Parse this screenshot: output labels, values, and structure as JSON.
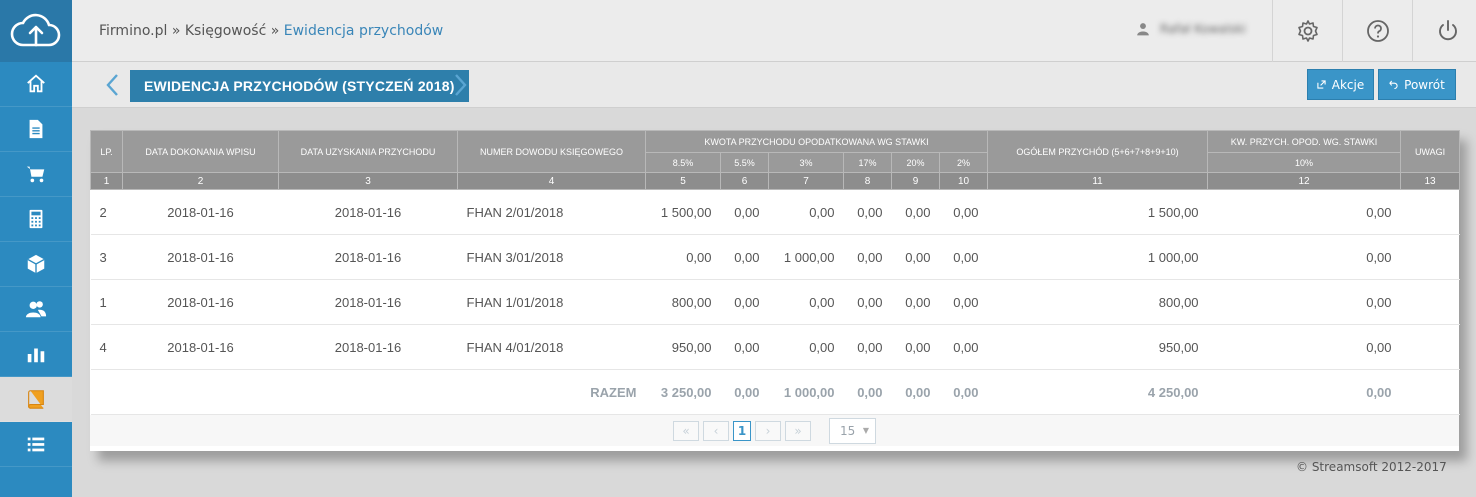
{
  "sidebar": {
    "items": [
      {
        "icon": "home-icon"
      },
      {
        "icon": "document-icon"
      },
      {
        "icon": "cart-icon"
      },
      {
        "icon": "calculator-icon"
      },
      {
        "icon": "box-icon"
      },
      {
        "icon": "users-icon"
      },
      {
        "icon": "bar-chart-icon"
      },
      {
        "icon": "book-icon",
        "active": true
      },
      {
        "icon": "list-icon"
      }
    ]
  },
  "topbar": {
    "breadcrumb": {
      "part1": "Firmino.pl",
      "sep": " » ",
      "part2": "Księgowość",
      "current": "Ewidencja przychodów"
    },
    "user_name": "Rafał Kowalski"
  },
  "header": {
    "title": "EWIDENCJA PRZYCHODÓW (STYCZEŃ 2018)",
    "actions_label": "Akcje",
    "back_label": "Powrót"
  },
  "table": {
    "headers": {
      "lp": "LP.",
      "date_entry": "DATA DOKONANIA WPISU",
      "date_income": "DATA UZYSKANIA PRZYCHODU",
      "doc_number": "NUMER DOWODU KSIĘGOWEGO",
      "amount_group": "KWOTA PRZYCHODU OPODATKOWANA WG STAWKI",
      "rates": [
        "8.5%",
        "5.5%",
        "3%",
        "17%",
        "20%",
        "2%"
      ],
      "total": "OGÓŁEM PRZYCHÓD (5+6+7+8+9+10)",
      "kw_group": "KW. PRZYCH. OPOD. WG. STAWKI",
      "kw_rate": "10%",
      "notes": "UWAGI",
      "col_numbers": [
        "1",
        "2",
        "3",
        "4",
        "5",
        "6",
        "7",
        "8",
        "9",
        "10",
        "11",
        "12",
        "13"
      ]
    },
    "rows": [
      {
        "lp": "2",
        "date_entry": "2018-01-16",
        "date_income": "2018-01-16",
        "doc": "FHAN 2/01/2018",
        "r85": "1 500,00",
        "r55": "0,00",
        "r3": "0,00",
        "r17": "0,00",
        "r20": "0,00",
        "r2": "0,00",
        "total": "1 500,00",
        "kw10": "0,00",
        "notes": ""
      },
      {
        "lp": "3",
        "date_entry": "2018-01-16",
        "date_income": "2018-01-16",
        "doc": "FHAN 3/01/2018",
        "r85": "0,00",
        "r55": "0,00",
        "r3": "1 000,00",
        "r17": "0,00",
        "r20": "0,00",
        "r2": "0,00",
        "total": "1 000,00",
        "kw10": "0,00",
        "notes": ""
      },
      {
        "lp": "1",
        "date_entry": "2018-01-16",
        "date_income": "2018-01-16",
        "doc": "FHAN 1/01/2018",
        "r85": "800,00",
        "r55": "0,00",
        "r3": "0,00",
        "r17": "0,00",
        "r20": "0,00",
        "r2": "0,00",
        "total": "800,00",
        "kw10": "0,00",
        "notes": ""
      },
      {
        "lp": "4",
        "date_entry": "2018-01-16",
        "date_income": "2018-01-16",
        "doc": "FHAN 4/01/2018",
        "r85": "950,00",
        "r55": "0,00",
        "r3": "0,00",
        "r17": "0,00",
        "r20": "0,00",
        "r2": "0,00",
        "total": "950,00",
        "kw10": "0,00",
        "notes": ""
      }
    ],
    "totals": {
      "label": "RAZEM",
      "r85": "3 250,00",
      "r55": "0,00",
      "r3": "1 000,00",
      "r17": "0,00",
      "r20": "0,00",
      "r2": "0,00",
      "total": "4 250,00",
      "kw10": "0,00"
    }
  },
  "pager": {
    "current_page": "1",
    "page_size": "15"
  },
  "footer": {
    "copyright": "© Streamsoft 2012-2017"
  },
  "colors": {
    "sidebar": "#2c8ac0",
    "accent": "#2e7fab",
    "header_gray": "#9a9a9a"
  }
}
